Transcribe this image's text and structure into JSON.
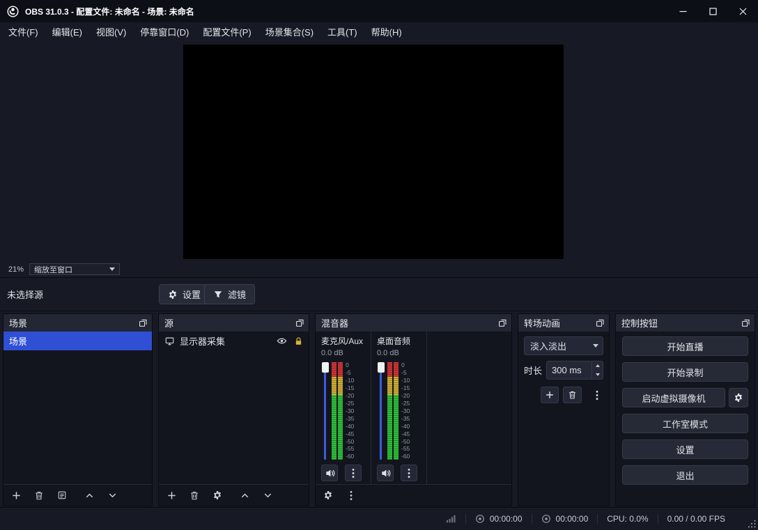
{
  "window": {
    "title": "OBS 31.0.3 - 配置文件: 未命名 - 场景: 未命名"
  },
  "menu": {
    "items": [
      "文件(F)",
      "编辑(E)",
      "视图(V)",
      "停靠窗口(D)",
      "配置文件(P)",
      "场景集合(S)",
      "工具(T)",
      "帮助(H)"
    ]
  },
  "preview": {
    "zoom_percent": "21%",
    "zoom_mode": "缩放至窗口"
  },
  "source_toolbar": {
    "status_text": "未选择源",
    "properties_button": "设置",
    "filters_button": "滤镜"
  },
  "scenes_dock": {
    "title": "场景",
    "items": [
      {
        "label": "场景",
        "selected": true
      }
    ]
  },
  "sources_dock": {
    "title": "源",
    "items": [
      {
        "label": "显示器采集"
      }
    ]
  },
  "mixer_dock": {
    "title": "混音器",
    "channels": [
      {
        "name": "麦克风/Aux",
        "volume": "0.0 dB"
      },
      {
        "name": "桌面音频",
        "volume": "0.0 dB"
      }
    ],
    "scale_ticks": [
      "0",
      "-5",
      "-10",
      "-15",
      "-20",
      "-25",
      "-30",
      "-35",
      "-40",
      "-45",
      "-50",
      "-55",
      "-60"
    ]
  },
  "transitions_dock": {
    "title": "转场动画",
    "current_transition": "淡入淡出",
    "duration_label": "时长",
    "duration_value": "300 ms"
  },
  "controls_dock": {
    "title": "控制按钮",
    "start_streaming": "开始直播",
    "start_recording": "开始录制",
    "start_virtual_camera": "启动虚拟摄像机",
    "studio_mode": "工作室模式",
    "settings": "设置",
    "exit": "退出"
  },
  "status_bar": {
    "stream_time": "00:00:00",
    "record_time": "00:00:00",
    "cpu": "CPU: 0.0%",
    "fps": "0.00 / 0.00 FPS"
  },
  "colors": {
    "selection_accent": "#2f4fd4",
    "meter_red": "#cf3535",
    "meter_yellow": "#cfae33",
    "meter_green": "#2fbf3a",
    "fader_blue": "#3d5bdc",
    "lock_gold": "#d8b62a",
    "titlebar_bg": "#0d0f17",
    "window_bg": "#171a24",
    "dock_header_bg": "#232633",
    "dock_body_bg": "#13151e"
  }
}
